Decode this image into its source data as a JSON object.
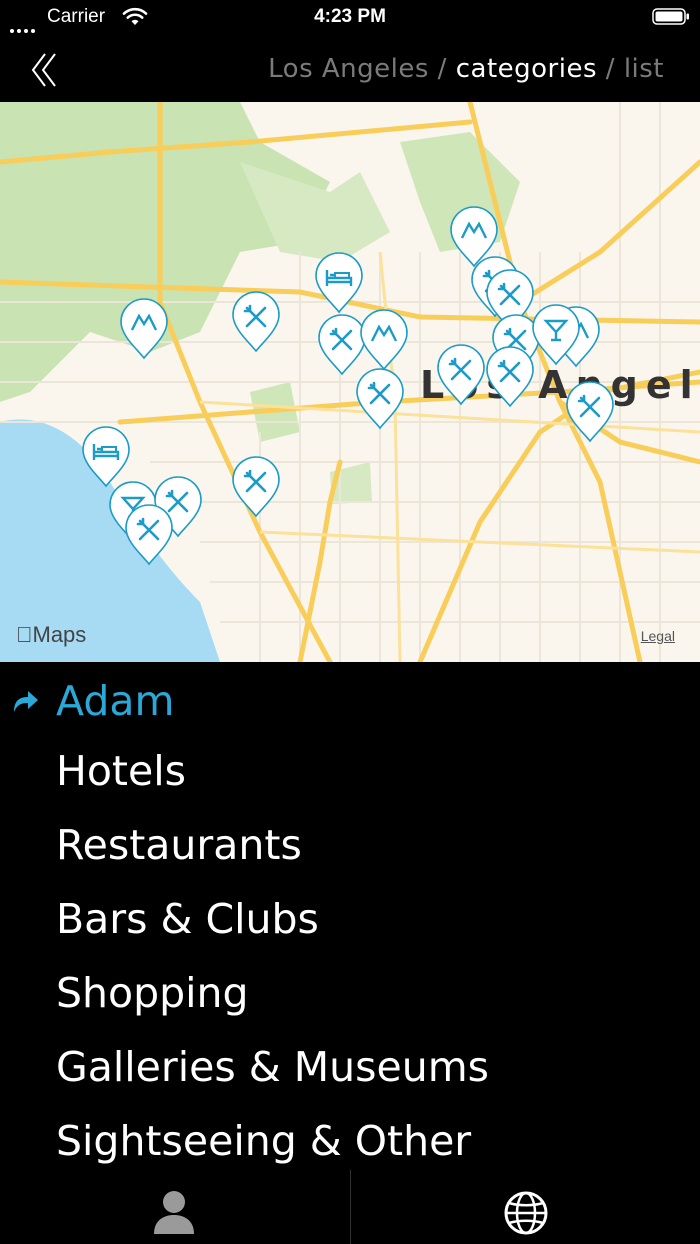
{
  "status_bar": {
    "carrier": "Carrier",
    "time": "4:23 PM"
  },
  "nav": {
    "back_icon": "double-chevron-left-icon",
    "breadcrumb": {
      "city": "Los Angeles",
      "sep1": " / ",
      "current": "categories",
      "sep2": " / ",
      "list": "list"
    }
  },
  "map": {
    "city_label": "Los Angele",
    "logo": "Maps",
    "legal": "Legal",
    "pins": [
      {
        "type": "mountain"
      },
      {
        "type": "hotel"
      },
      {
        "type": "restaurant"
      },
      {
        "type": "mountain"
      },
      {
        "type": "restaurant"
      },
      {
        "type": "mountain"
      },
      {
        "type": "restaurant"
      },
      {
        "type": "restaurant"
      },
      {
        "type": "mountain"
      },
      {
        "type": "restaurant"
      },
      {
        "type": "restaurant"
      },
      {
        "type": "bar"
      },
      {
        "type": "restaurant"
      },
      {
        "type": "restaurant"
      },
      {
        "type": "restaurant"
      },
      {
        "type": "hotel"
      },
      {
        "type": "bar"
      },
      {
        "type": "restaurant"
      },
      {
        "type": "restaurant"
      },
      {
        "type": "restaurant"
      }
    ],
    "colors": {
      "pin": "#1b9bc8",
      "water": "#a6dbf3",
      "park": "#c9e3b2",
      "highway": "#f8cd5a",
      "land": "#faf6ee"
    }
  },
  "categories": {
    "user": "Adam",
    "items": [
      "Hotels",
      "Restaurants",
      "Bars & Clubs",
      "Shopping",
      "Galleries & Museums",
      "Sightseeing & Other"
    ],
    "accent": "#2aa9d8"
  },
  "tab_bar": {
    "left_icon": "person-icon",
    "right_icon": "globe-icon"
  }
}
